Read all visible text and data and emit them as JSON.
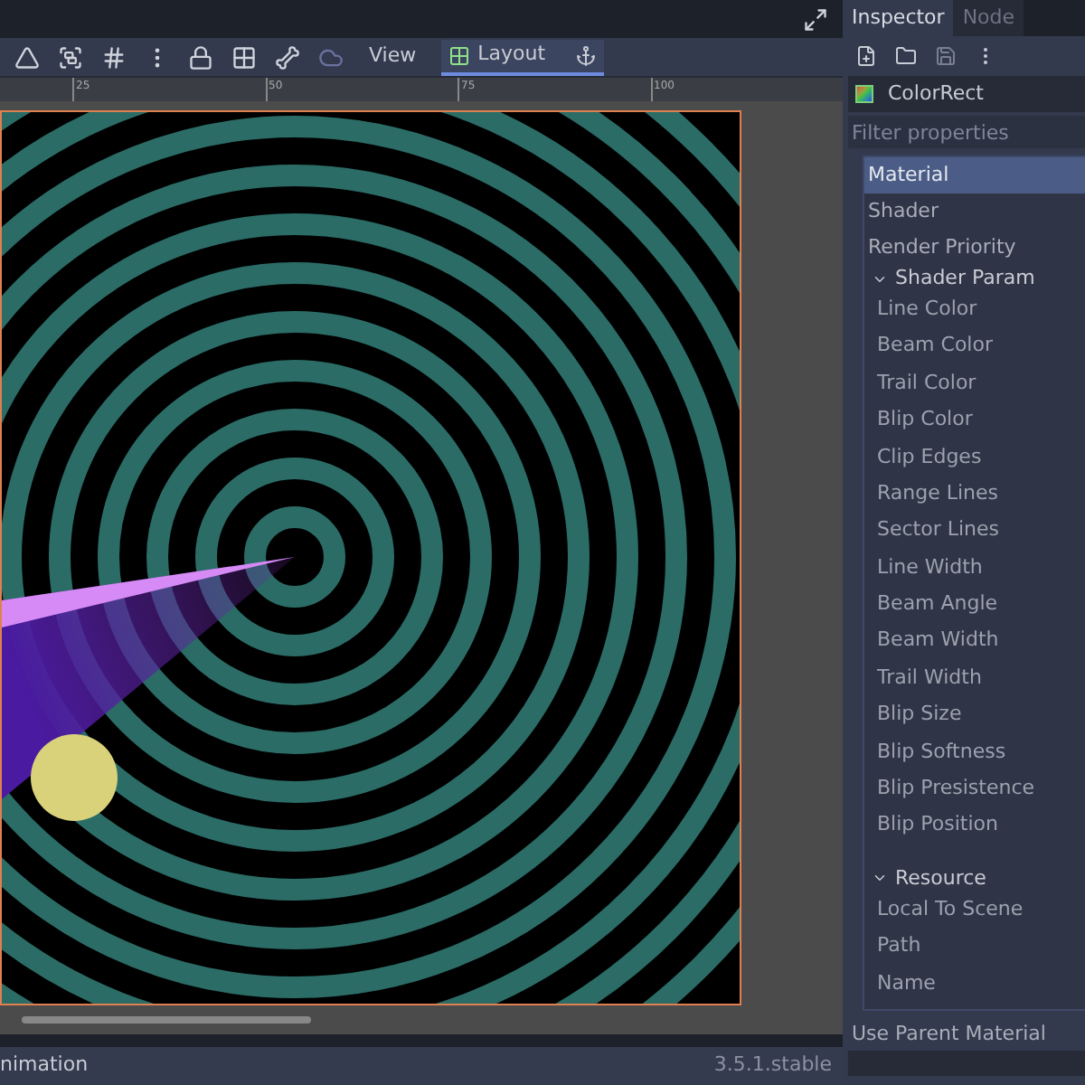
{
  "toolbar": {
    "view_label": "View",
    "layout_label": "Layout",
    "layout_active": true
  },
  "ruler": {
    "labels": [
      "25",
      "50",
      "75",
      "100"
    ]
  },
  "status_bar": {
    "left": "nimation",
    "version": "3.5.1.stable"
  },
  "inspector": {
    "tabs": [
      {
        "label": "Inspector",
        "selected": true
      },
      {
        "label": "Node",
        "selected": false
      }
    ],
    "node_name": "ColorRect",
    "filter": {
      "placeholder": "Filter properties"
    },
    "properties": [
      {
        "label": "Material",
        "selected": true
      },
      {
        "label": "Shader",
        "selected": false
      },
      {
        "label": "Render Priority",
        "selected": false
      }
    ],
    "sections": [
      {
        "title": "Shader Param",
        "expanded": true,
        "children": [
          {
            "label": "Line Color"
          },
          {
            "label": "Beam Color"
          },
          {
            "label": "Trail Color"
          },
          {
            "label": "Blip Color"
          },
          {
            "label": "Clip Edges"
          },
          {
            "label": "Range Lines"
          },
          {
            "label": "Sector Lines"
          },
          {
            "label": "Line Width"
          },
          {
            "label": "Beam Angle"
          },
          {
            "label": "Beam Width"
          },
          {
            "label": "Trail Width"
          },
          {
            "label": "Blip Size"
          },
          {
            "label": "Blip Softness"
          },
          {
            "label": "Blip Presistence"
          },
          {
            "label": "Blip Position"
          }
        ]
      },
      {
        "title": "Resource",
        "expanded": true,
        "children": [
          {
            "label": "Local To Scene"
          },
          {
            "label": "Path"
          },
          {
            "label": "Name"
          }
        ]
      }
    ],
    "footer_label": "Use Parent Material"
  }
}
